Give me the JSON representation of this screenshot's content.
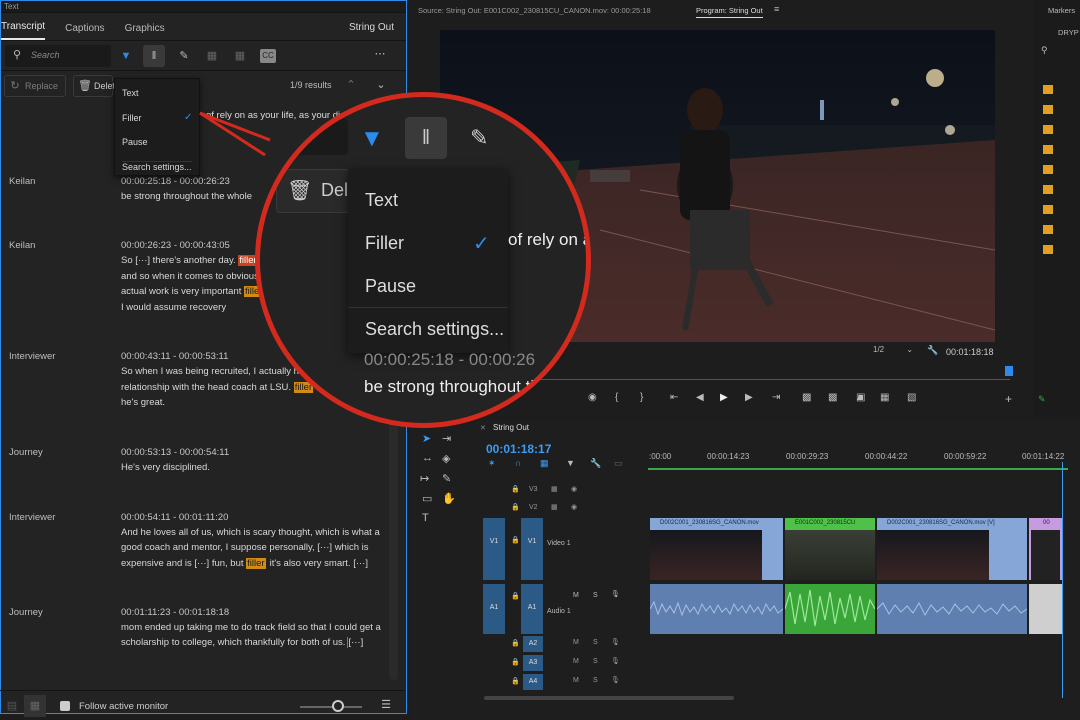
{
  "panel_title": "Text",
  "tabs": [
    "Transcript",
    "Captions",
    "Graphics"
  ],
  "string_out": "String Out",
  "search": {
    "placeholder": "Search",
    "results": "1/9 results"
  },
  "replace_label": "Replace",
  "delete_label": "Delete",
  "filter_menu": {
    "items": [
      "Text",
      "Filler",
      "Pause",
      "Search settings..."
    ],
    "checked": "Filler"
  },
  "context_line": "of rely on as your life, as your diet",
  "entries": [
    {
      "speaker": "Keilan",
      "time": "00:00:25:18 - 00:00:26:23",
      "lines": [
        "be strong throughout the whole"
      ]
    },
    {
      "speaker": "Keilan",
      "time": "00:00:26:23 - 00:00:43:05",
      "lines": [
        "So [···] there's another day. ",
        "and so when it comes to obvious",
        "actual work is very important ",
        "I would assume recovery"
      ],
      "fillers": [
        "filler",
        "filler"
      ]
    },
    {
      "speaker": "Interviewer",
      "time": "00:00:43:11 - 00:00:53:11",
      "lines": [
        "So when I was being recruited, I actually h",
        "relationship with the head coach at LSU. ",
        "he's great."
      ],
      "fillers": [
        "filler"
      ]
    },
    {
      "speaker": "Journey",
      "time": "00:00:53:13 - 00:00:54:11",
      "lines": [
        "He's very disciplined."
      ]
    },
    {
      "speaker": "Interviewer",
      "time": "00:00:54:11 - 00:01:11:20",
      "lines": [
        "And he loves all of us, which is scary thought, which is what a",
        "good coach and mentor, I suppose personally, [···] which is",
        "expensive and is [···] fun, but ",
        "it's also very smart. [···]"
      ],
      "fillers": [
        "filler"
      ]
    },
    {
      "speaker": "Journey",
      "time": "00:01:11:23 - 00:01:18:18",
      "lines": [
        "mom ended up taking me to do track field so that I could get a",
        "scholarship to college, which thankfully for both of us.",
        "[···]"
      ]
    }
  ],
  "footer": {
    "follow_label": "Follow active monitor"
  },
  "source_label": "Source: String Out: E001C002_230815CU_CANON.mov: 00:00:25:18",
  "program_label": "Program: String Out",
  "markers_label": "Markers",
  "right_tab": "DRYP",
  "zoom_select": "1/2",
  "program_time": "00:01:18:18",
  "magnifier": {
    "menu": [
      "Text",
      "Filler",
      "Pause",
      "Search settings..."
    ],
    "delete_partial": "Dele",
    "line1": "of rely on a",
    "time_partial": "00:00:25:18 - 00:00:26",
    "line2": "be strong throughout th"
  },
  "timeline": {
    "tab": "String Out",
    "timecode": "00:01:18:17",
    "ruler": [
      ":00:00",
      "00:00:14:23",
      "00:00:29:23",
      "00:00:44:22",
      "00:00:59:22",
      "00:01:14:22"
    ],
    "tracks_video": [
      "V3",
      "V2",
      "V1"
    ],
    "video1_label": "Video 1",
    "audio1_label": "Audio 1",
    "tracks_audio": [
      "A1",
      "A2",
      "A3",
      "A4"
    ],
    "clips": [
      "D002C001_230816SG_CANON.mov",
      "E001C002_230815CU",
      "D002C001_230816SG_CANON.mov [V]",
      "00"
    ]
  },
  "colors": {
    "accent": "#2d8ceb",
    "filler": "#d28b15",
    "magnifier": "#d42a1e",
    "green": "#37a94a"
  }
}
